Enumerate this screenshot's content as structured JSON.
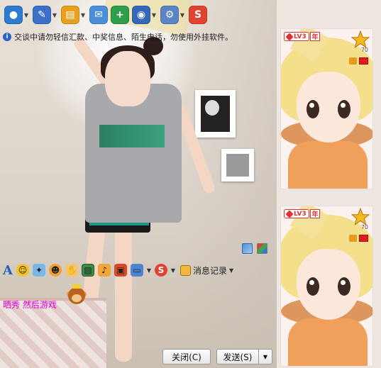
{
  "toolbar": {
    "buttons": [
      {
        "name": "video-call",
        "color": "#2d7ad1",
        "glyph": "●",
        "has_arrow": true
      },
      {
        "name": "voice-call",
        "color": "#3b6fc8",
        "glyph": "✎",
        "has_arrow": true
      },
      {
        "name": "send-file",
        "color": "#e8a11c",
        "glyph": "▤",
        "has_arrow": true
      },
      {
        "name": "send-sms",
        "color": "#4a8fd8",
        "glyph": "✉",
        "has_arrow": false
      },
      {
        "name": "create-group",
        "color": "#2f9d4a",
        "glyph": "+",
        "has_arrow": false
      },
      {
        "name": "remote-assist",
        "color": "#3568b8",
        "glyph": "◉",
        "has_arrow": true
      },
      {
        "name": "app-settings",
        "color": "#5a84c4",
        "glyph": "⚙",
        "has_arrow": true
      },
      {
        "name": "soso-search",
        "color": "#e04431",
        "glyph": "S",
        "has_arrow": false
      }
    ]
  },
  "notice": {
    "text": "交谈中请勿轻信汇款、中奖信息、陌生电话，勿使用外挂软件。"
  },
  "tools": {
    "history_label": "消息记录"
  },
  "input": {
    "text": "晒秀 然后游戏"
  },
  "buttons": {
    "close_label": "关闭(C)",
    "send_label": "发送(S)"
  },
  "panels": {
    "top": {
      "level": "LV3",
      "year_badge": "年",
      "star_number": "70"
    },
    "bottom": {
      "level": "LV3",
      "year_badge": "年",
      "star_number": "70"
    }
  },
  "colors": {
    "accent_blue": "#2a62c9",
    "input_text": "#e000e0",
    "level_red": "#d33333"
  }
}
